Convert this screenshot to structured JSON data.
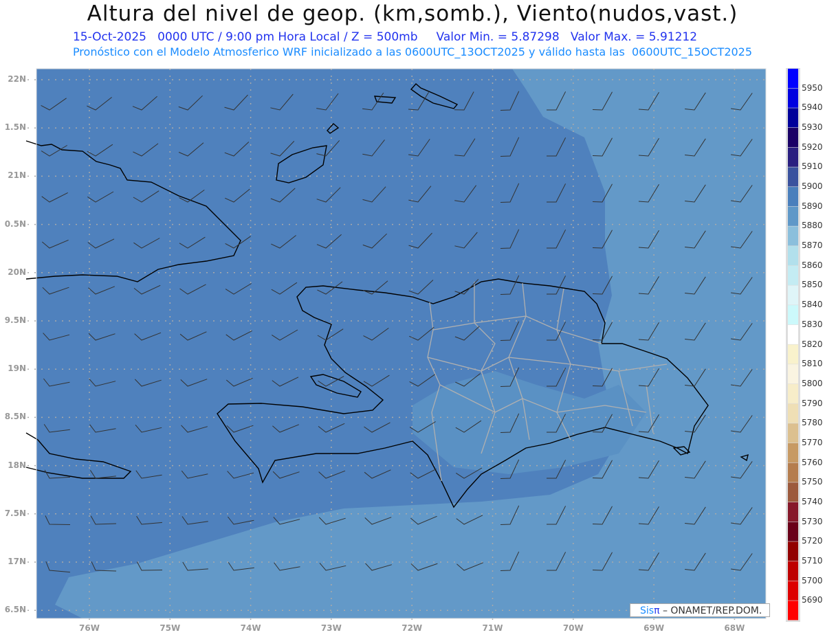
{
  "header": {
    "title": "Altura del nivel de geop. (km,somb.), Viento(nudos,vast.)",
    "subtitle": "15-Oct-2025   0000 UTC / 9:00 pm Hora Local / Z = 500mb     Valor Min. = 5.87298   Valor Max. = 5.91212",
    "forecast_info": "Pronóstico con el Modelo Atmosferico WRF inicializado a las 0600UTC_13OCT2025 y válido hasta las  0600UTC_15OCT2025"
  },
  "axes": {
    "lat_labels": [
      "22N",
      "1.5N",
      "21N",
      "0.5N",
      "20N",
      "9.5N",
      "19N",
      "8.5N",
      "18N",
      "7.5N",
      "17N",
      "6.5N"
    ],
    "lon_labels": [
      "76W",
      "75W",
      "74W",
      "73W",
      "72W",
      "71W",
      "70W",
      "69W",
      "68W"
    ]
  },
  "colorbar": {
    "labels": [
      "5950",
      "5940",
      "5930",
      "5920",
      "5910",
      "5900",
      "5890",
      "5880",
      "5870",
      "5860",
      "5850",
      "5840",
      "5830",
      "5820",
      "5810",
      "5800",
      "5790",
      "5780",
      "5770",
      "5760",
      "5750",
      "5740",
      "5730",
      "5720",
      "5710",
      "5700",
      "5690"
    ],
    "colors": [
      "#0000ff",
      "#0000e0",
      "#00009a",
      "#1a0066",
      "#2a1f80",
      "#3a529e",
      "#4a7fbc",
      "#5f98c8",
      "#8bbfdc",
      "#b2e0ec",
      "#c4ecf3",
      "#dff5f8",
      "#ccf9fb",
      "#ffffff",
      "#f9f2cc",
      "#faf4e1",
      "#f7edc9",
      "#efdfb5",
      "#dcc08f",
      "#c79a64",
      "#b57d4e",
      "#9c5a3c",
      "#86182a",
      "#6a0019",
      "#920000",
      "#be0000",
      "#dd0000",
      "#ff0000"
    ]
  },
  "credit": {
    "sis": "Sis",
    "pi": "π",
    "rest": " – ONAMET/REP.DOM."
  },
  "colors": {
    "dark_field": "#4f81bd",
    "light_field": "#6399c8",
    "coast": "#000000",
    "provinces": "#b0b0b0"
  }
}
